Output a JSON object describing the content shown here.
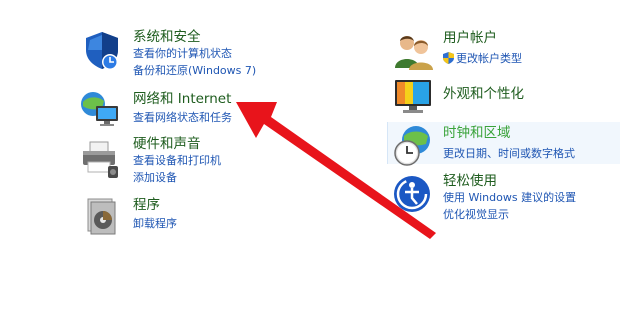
{
  "left_column": [
    {
      "title": "系统和安全",
      "icon": "shield-security-icon",
      "links": [
        "查看你的计算机状态",
        "备份和还原(Windows 7)"
      ]
    },
    {
      "title": "网络和 Internet",
      "icon": "network-globe-icon",
      "links": [
        "查看网络状态和任务"
      ]
    },
    {
      "title": "硬件和声音",
      "icon": "printer-hardware-icon",
      "links": [
        "查看设备和打印机",
        "添加设备"
      ]
    },
    {
      "title": "程序",
      "icon": "program-disk-icon",
      "links": [
        "卸载程序"
      ]
    }
  ],
  "right_column": [
    {
      "title": "用户帐户",
      "icon": "user-accounts-icon",
      "links": [
        "更改帐户类型"
      ]
    },
    {
      "title": "外观和个性化",
      "icon": "monitor-appearance-icon",
      "links": []
    },
    {
      "title": "时钟和区域",
      "icon": "clock-globe-icon",
      "links": [
        "更改日期、时间或数字格式"
      ],
      "highlighted": true
    },
    {
      "title": "轻松使用",
      "icon": "ease-of-access-icon",
      "links": [
        "使用 Windows 建议的设置",
        "优化视觉显示"
      ]
    }
  ],
  "colors": {
    "title_green": "#1e5c1e",
    "hover_green": "#3aa33a",
    "link_blue": "#1f56b3",
    "arrow_red": "#e8141b"
  },
  "annotation": "red-pointer-arrow"
}
